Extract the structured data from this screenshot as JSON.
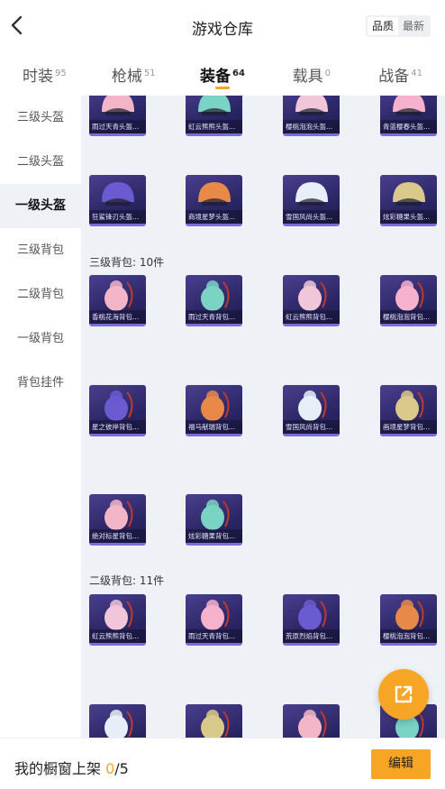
{
  "header": {
    "title": "游戏仓库",
    "sort_options": [
      "品质",
      "最新"
    ],
    "sort_active": 0
  },
  "tabs": [
    {
      "label": "时装",
      "count": "95"
    },
    {
      "label": "枪械",
      "count": "51"
    },
    {
      "label": "装备",
      "count": "64"
    },
    {
      "label": "载具",
      "count": "0"
    },
    {
      "label": "战备",
      "count": "41"
    }
  ],
  "active_tab": 2,
  "categories": [
    "三级头盔",
    "二级头盔",
    "一级头盔",
    "三级背包",
    "二级背包",
    "一级背包",
    "背包挂件"
  ],
  "active_category": 2,
  "sections": [
    {
      "title": "",
      "items": [
        "雨过天青头盔...",
        "虹云熊熊头盔...",
        "樱桃泡泡头盔...",
        "青蓝樱春头盔..."
      ]
    },
    {
      "title": "",
      "items": [
        "狂鲨锋刃头盔...",
        "商境星梦头盔...",
        "雪国风尚头盔...",
        "炫彩糖果头盔..."
      ]
    },
    {
      "title": "三级背包: 10件",
      "items": [
        "香桃花海背包...",
        "雨过天青背包...",
        "虹云熊熊背包...",
        "樱桃泡泡背包...",
        "星之彼岸背包...",
        "福马献瑞背包...",
        "雪国风尚背包...",
        "画境星梦背包...",
        "绝对标星背包...",
        "炫彩糖果背包..."
      ]
    },
    {
      "title": "二级背包: 11件",
      "items": [
        "虹云熊熊背包...",
        "雨过天青背包...",
        "荒原烈焰背包...",
        "樱桃泡泡背包...",
        "",
        "",
        "",
        ""
      ]
    }
  ],
  "footer": {
    "label": "我的橱窗上架 ",
    "current": "0",
    "total": "/5",
    "edit": "编辑"
  },
  "colors": {
    "accent": "#f7a524",
    "card_bg": "#2c2766",
    "content_bg": "#eef1f6"
  }
}
